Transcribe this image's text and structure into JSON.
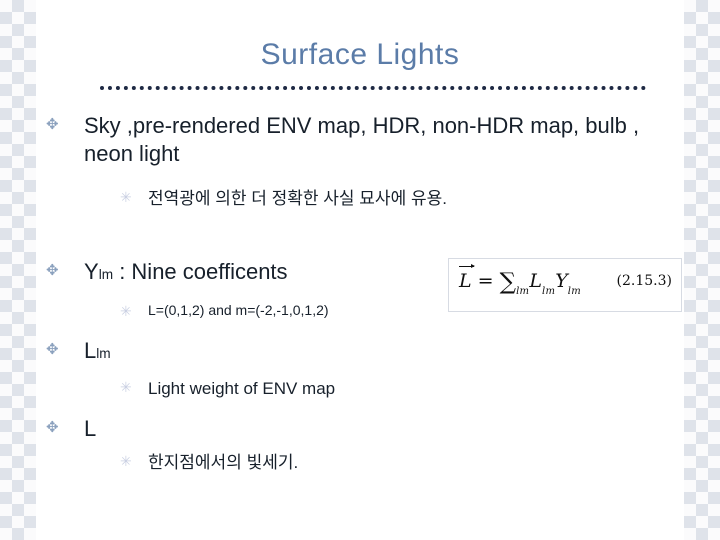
{
  "slide": {
    "title": "Surface Lights",
    "bullets": [
      {
        "marker": "✥",
        "text": "Sky ,pre-rendered ENV map, HDR, non-HDR map, bulb , neon light",
        "sub": [
          {
            "marker": "✳",
            "text": "전역광에 의한 더 정확한 사실 묘사에 유용."
          }
        ]
      },
      {
        "marker": "✥",
        "text_main": "Y",
        "text_sub": "lm",
        "text_rest": " : Nine coefficents",
        "sub": [
          {
            "marker": "✳",
            "text": "L=(0,1,2) and m=(-2,-1,0,1,2)"
          }
        ]
      },
      {
        "marker": "✥",
        "text_main": "L",
        "text_sub": "lm",
        "text_rest": "",
        "sub": [
          {
            "marker": "✳",
            "text": " Light weight of ENV map"
          }
        ]
      },
      {
        "marker": "✥",
        "text_main": "L",
        "text_sub": "",
        "text_rest": "",
        "sub": [
          {
            "marker": "✳",
            "text": "한지점에서의 빛세기."
          }
        ]
      }
    ],
    "formula": {
      "lhs": "L",
      "equals": "=",
      "sum": "∑",
      "sum_sub": "lm",
      "term1": "L",
      "term1_sub": "lm",
      "term2": "Y",
      "term2_sub": "lm",
      "tag": "(2.15.3)"
    }
  }
}
